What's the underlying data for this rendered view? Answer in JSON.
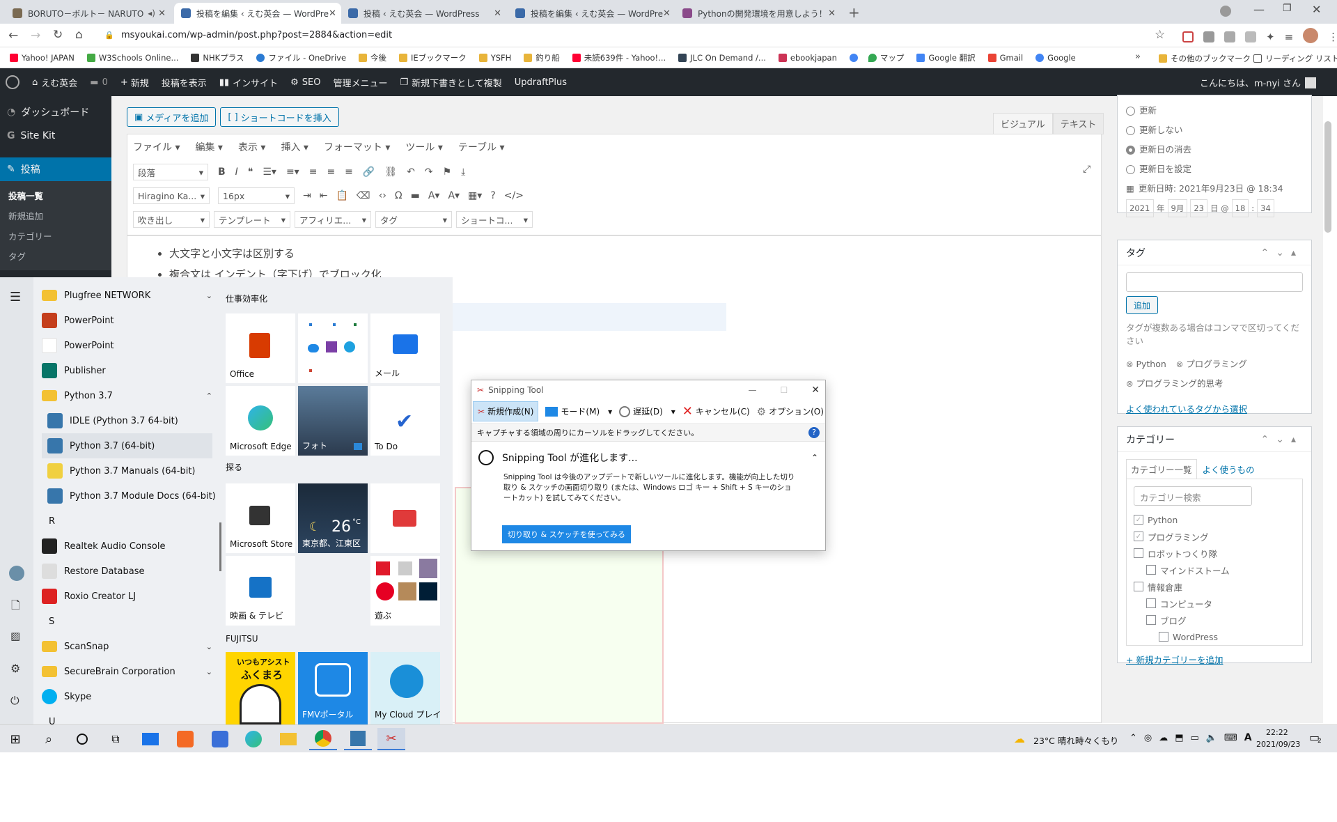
{
  "browser": {
    "tabs": [
      {
        "title": "BORUTO－ボルト－ NARUTO",
        "favicon_color": "#7a6a52"
      },
      {
        "title": "投稿を編集 ‹ えむ英会 — WordPre",
        "favicon_color": "#3b6aa8"
      },
      {
        "title": "投稿 ‹ えむ英会 — WordPress",
        "favicon_color": "#3b6aa8"
      },
      {
        "title": "投稿を編集 ‹ えむ英会 — WordPre",
        "favicon_color": "#3b6aa8"
      },
      {
        "title": "Pythonの開発環境を用意しよう！",
        "favicon_color": "#8a4a8a"
      }
    ],
    "url": "msyoukai.com/wp-admin/post.php?post=2884&action=edit",
    "bookmarks": [
      "Yahoo! JAPAN",
      "W3Schools Online...",
      "NHKプラス",
      "ファイル - OneDrive",
      "今後",
      "IEブックマーク",
      "YSFH",
      "釣り船",
      "未読639件 - Yahoo!...",
      "JLC On Demand /...",
      "ebookjapan",
      "マップ",
      "Google 翻訳",
      "Gmail",
      "Google"
    ],
    "bookmarks_right": [
      "その他のブックマーク",
      "リーディング リスト"
    ]
  },
  "wp": {
    "adminbar": {
      "site": "えむ英会",
      "comments": "0",
      "new": "新規",
      "view": "投稿を表示",
      "insight": "インサイト",
      "seo": "SEO",
      "manage": "管理メニュー",
      "duplicate": "新規下書きとして複製",
      "updraft": "UpdraftPlus",
      "greeting": "こんにちは、m-nyi さん"
    },
    "menu": {
      "dashboard": "ダッシュボード",
      "sitekit": "Site Kit",
      "posts": "投稿",
      "sub": [
        "投稿一覧",
        "新規追加",
        "カテゴリー",
        "タグ"
      ]
    },
    "editor": {
      "add_media": "メディアを追加",
      "add_shortcode": "ショートコードを挿入",
      "tab_visual": "ビジュアル",
      "tab_text": "テキスト",
      "menus": [
        "ファイル",
        "編集",
        "表示",
        "挿入",
        "フォーマット",
        "ツール",
        "テーブル"
      ],
      "format_select": "段落",
      "font_select": "Hiragino Ka...",
      "size_select": "16px",
      "row3": [
        "吹き出し",
        "テンプレート",
        "アフィリエ...",
        "タグ",
        "ショートコ..."
      ],
      "content": [
        "大文字と小文字は区別する",
        "複合文は インデント（字下げ）でブロック化"
      ]
    },
    "sidebar": {
      "update_options": [
        "更新",
        "更新しない",
        "更新日の消去",
        "更新日を設定"
      ],
      "update_date_label": "更新日時: 2021年9月23日 @ 18:34",
      "date_fields": {
        "year": "2021",
        "year_unit": "年",
        "month": "9月",
        "day": "23",
        "day_unit": "日 @",
        "hour": "18",
        "sep": ":",
        "minute": "34"
      },
      "tags_title": "タグ",
      "tag_add": "追加",
      "tag_hint": "タグが複数ある場合はコンマで区切ってください",
      "tags": [
        "Python",
        "プログラミング",
        "プログラミング的思考"
      ],
      "tag_popular": "よく使われているタグから選択",
      "cat_title": "カテゴリー",
      "cat_tab_all": "カテゴリー一覧",
      "cat_tab_popular": "よく使うもの",
      "cat_search": "カテゴリー検索",
      "categories": [
        {
          "name": "Python",
          "checked": true,
          "level": 0
        },
        {
          "name": "プログラミング",
          "checked": true,
          "level": 0
        },
        {
          "name": "ロボットつくり隊",
          "checked": false,
          "level": 0
        },
        {
          "name": "マインドストーム",
          "checked": false,
          "level": 1
        },
        {
          "name": "情報倉庫",
          "checked": false,
          "level": 0
        },
        {
          "name": "コンピュータ",
          "checked": false,
          "level": 1
        },
        {
          "name": "ブログ",
          "checked": false,
          "level": 1
        },
        {
          "name": "WordPress",
          "checked": false,
          "level": 2
        }
      ],
      "cat_add": "+ 新規カテゴリーを追加"
    }
  },
  "startmenu": {
    "apps": [
      {
        "label": "Plugfree NETWORK",
        "type": "folder",
        "chevron": true
      },
      {
        "label": "PowerPoint",
        "type": "ppt"
      },
      {
        "label": "PowerPoint",
        "type": "ppt2"
      },
      {
        "label": "Publisher",
        "type": "pub"
      },
      {
        "label": "Python 3.7",
        "type": "folder",
        "chevron": true,
        "open": true
      },
      {
        "label": "IDLE (Python 3.7 64-bit)",
        "type": "py",
        "indent": true
      },
      {
        "label": "Python 3.7 (64-bit)",
        "type": "py",
        "indent": true,
        "hover": true
      },
      {
        "label": "Python 3.7 Manuals (64-bit)",
        "type": "doc",
        "indent": true
      },
      {
        "label": "Python 3.7 Module Docs (64-bit)",
        "type": "py",
        "indent": true
      },
      {
        "label": "R",
        "type": "letter"
      },
      {
        "label": "Realtek Audio Console",
        "type": "realtek"
      },
      {
        "label": "Restore Database",
        "type": "restore"
      },
      {
        "label": "Roxio Creator LJ",
        "type": "roxio"
      },
      {
        "label": "S",
        "type": "letter"
      },
      {
        "label": "ScanSnap",
        "type": "folder",
        "chevron": true
      },
      {
        "label": "SecureBrain Corporation",
        "type": "folder",
        "chevron": true
      },
      {
        "label": "Skype",
        "type": "skype"
      },
      {
        "label": "U",
        "type": "letter"
      }
    ],
    "groups": [
      "仕事効率化",
      "探る",
      "FUJITSU"
    ],
    "tiles": {
      "office": "Office",
      "mail": "メール",
      "edge": "Microsoft Edge",
      "photo": "フォト",
      "todo": "To Do",
      "store": "Microsoft Store",
      "weather_temp": "26",
      "weather_unit": "°C",
      "weather_place": "東京都、江東区",
      "movies": "映画 & テレビ",
      "play": "遊ぶ",
      "fukumaro_top": "いつもアシスト",
      "fukumaro": "ふくまろ",
      "fmv": "FMVポータル",
      "mycloud": "My Cloud プレイ"
    }
  },
  "snipping": {
    "title": "Snipping Tool",
    "new": "新規作成(N)",
    "mode": "モード(M)",
    "delay": "遅延(D)",
    "cancel": "キャンセル(C)",
    "options": "オプション(O)",
    "instruction": "キャプチャする領域の周りにカーソルをドラッグしてください。",
    "notice_title": "Snipping  Tool が進化します...",
    "notice_body": "Snipping Tool は今後のアップデートで新しいツールに進化します。機能が向上した切り取り & スケッチの画面切り取り (または、Windows ロゴ キー + Shift + S キーのショートカット) を試してみてください。",
    "try_button": "切り取り & スケッチを使ってみる"
  },
  "taskbar": {
    "weather": "23°C  晴れ時々くもり",
    "time": "22:22",
    "date": "2021/09/23",
    "notifications": "2"
  }
}
